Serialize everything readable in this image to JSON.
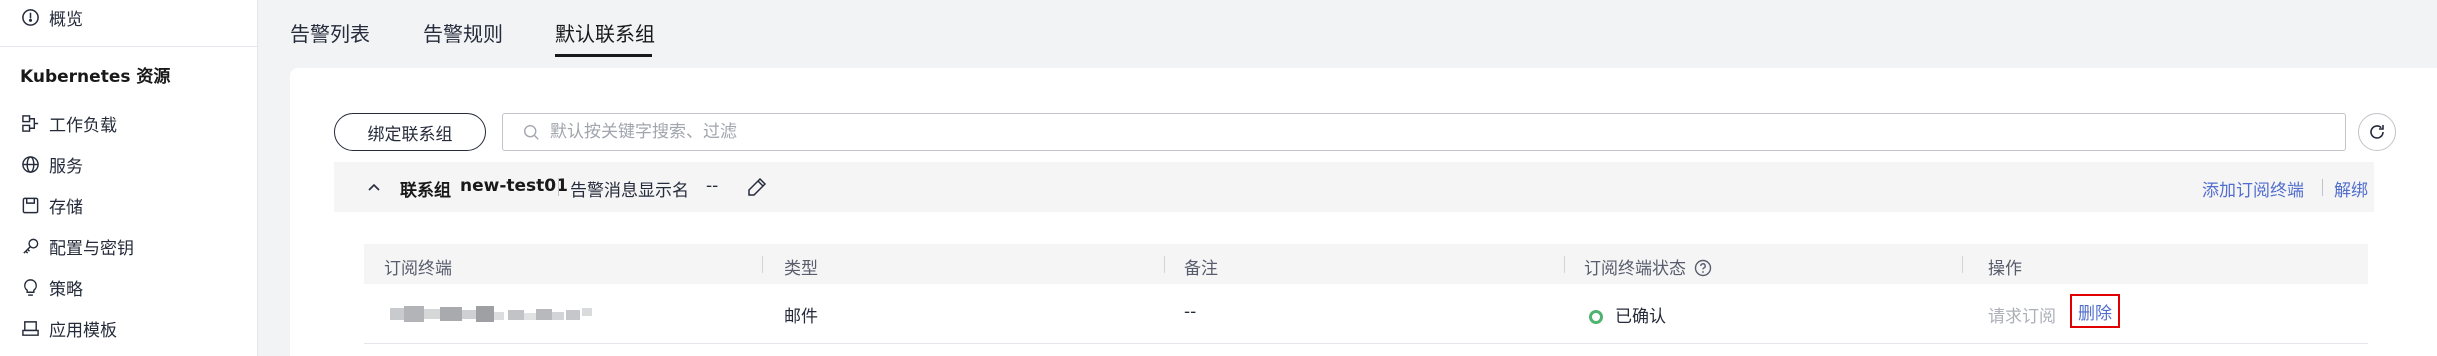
{
  "sidebar": {
    "overview": "概览",
    "group_title": "Kubernetes 资源",
    "items": [
      {
        "label": "工作负载",
        "icon": "workload-icon"
      },
      {
        "label": "服务",
        "icon": "globe-icon"
      },
      {
        "label": "存储",
        "icon": "storage-icon"
      },
      {
        "label": "配置与密钥",
        "icon": "key-icon"
      },
      {
        "label": "策略",
        "icon": "bulb-icon"
      },
      {
        "label": "应用模板",
        "icon": "template-icon"
      }
    ]
  },
  "tabs": [
    {
      "label": "告警列表",
      "active": false
    },
    {
      "label": "告警规则",
      "active": false
    },
    {
      "label": "默认联系组",
      "active": true
    }
  ],
  "toolbar": {
    "bind_button": "绑定联系组",
    "search_placeholder": "默认按关键字搜索、过滤"
  },
  "group": {
    "label": "联系组",
    "name": "new-test01",
    "message_label": "告警消息显示名",
    "message_value": "--",
    "add_link": "添加订阅终端",
    "unbind_link": "解绑"
  },
  "table": {
    "columns": [
      "订阅终端",
      "类型",
      "备注",
      "订阅终端状态",
      "操作"
    ],
    "rows": [
      {
        "endpoint": "",
        "type": "邮件",
        "remark": "--",
        "status": "已确认",
        "op_request": "请求订阅",
        "op_delete": "删除"
      }
    ]
  },
  "colors": {
    "link": "#526ecc",
    "status_ok": "#50b371",
    "highlight_border": "#e00000"
  }
}
